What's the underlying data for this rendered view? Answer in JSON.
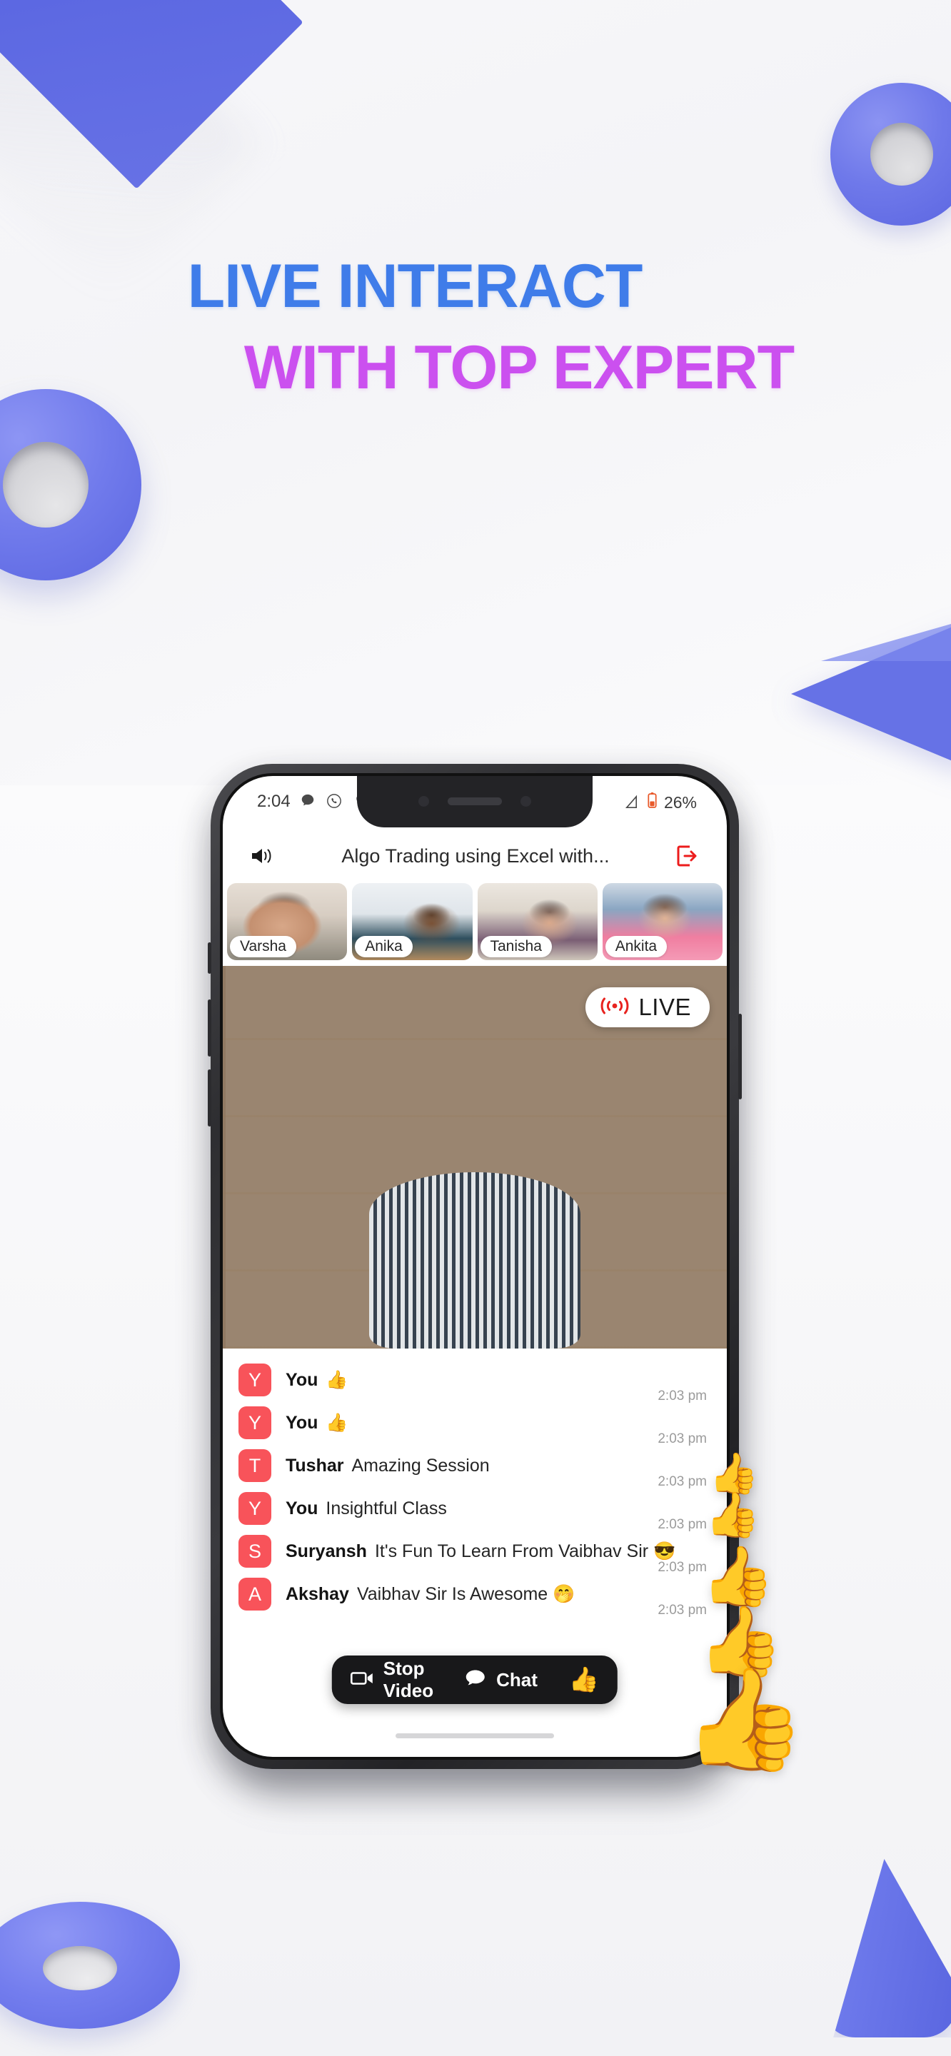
{
  "headline": {
    "line1": "LIVE INTERACT",
    "line2": "WITH TOP EXPERT",
    "color1": "#3f7ce9",
    "color2": "#cb50ef"
  },
  "phone": {
    "status_bar": {
      "time": "2:04",
      "icons": [
        "message-icon",
        "whatsapp-icon",
        "location-icon"
      ],
      "network": "signal-icon",
      "battery_icon": "battery-icon",
      "battery_percent": "26%"
    },
    "app_bar": {
      "speaker_icon": "speaker-icon",
      "title": "Algo Trading using Excel with...",
      "exit_icon": "exit-icon"
    },
    "participants": [
      {
        "name": "Varsha",
        "photo_class": "ph-varsha"
      },
      {
        "name": "Anika",
        "photo_class": "ph-anika"
      },
      {
        "name": "Tanisha",
        "photo_class": "ph-tanisha"
      },
      {
        "name": "Ankita",
        "photo_class": "ph-ankita"
      }
    ],
    "main_video": {
      "live_badge_label": "LIVE",
      "live_badge_icon": "broadcast-icon",
      "live_badge_color": "#e8231f"
    },
    "chat": {
      "avatar_color": "#f8535a",
      "messages": [
        {
          "initial": "Y",
          "name": "You",
          "text": "👍",
          "time": "2:03 pm"
        },
        {
          "initial": "Y",
          "name": "You",
          "text": "👍",
          "time": "2:03 pm"
        },
        {
          "initial": "T",
          "name": "Tushar",
          "text": "Amazing Session",
          "time": "2:03 pm"
        },
        {
          "initial": "Y",
          "name": "You",
          "text": "Insightful Class",
          "time": "2:03 pm"
        },
        {
          "initial": "S",
          "name": "Suryansh",
          "text": "It's Fun To Learn From Vaibhav Sir 😎",
          "time": "2:03 pm"
        },
        {
          "initial": "A",
          "name": "Akshay",
          "text": "Vaibhav Sir Is Awesome 🤭",
          "time": "2:03 pm"
        }
      ]
    },
    "controls": {
      "video_icon": "video-camera-icon",
      "video_label": "Stop Video",
      "chat_icon": "chat-bubble-icon",
      "chat_label": "Chat",
      "reaction_icon": "thumbs-up-icon",
      "reaction_emoji": "👍"
    },
    "floating_reactions": [
      "👍",
      "👍",
      "👍",
      "👍",
      "👍"
    ]
  },
  "decor": {
    "accent_purple": "#6672e6",
    "shapes": [
      "diagonal-band",
      "torus-top-right",
      "torus-left",
      "triangle-right",
      "torus-bottom-left",
      "cone-bottom-right"
    ]
  }
}
